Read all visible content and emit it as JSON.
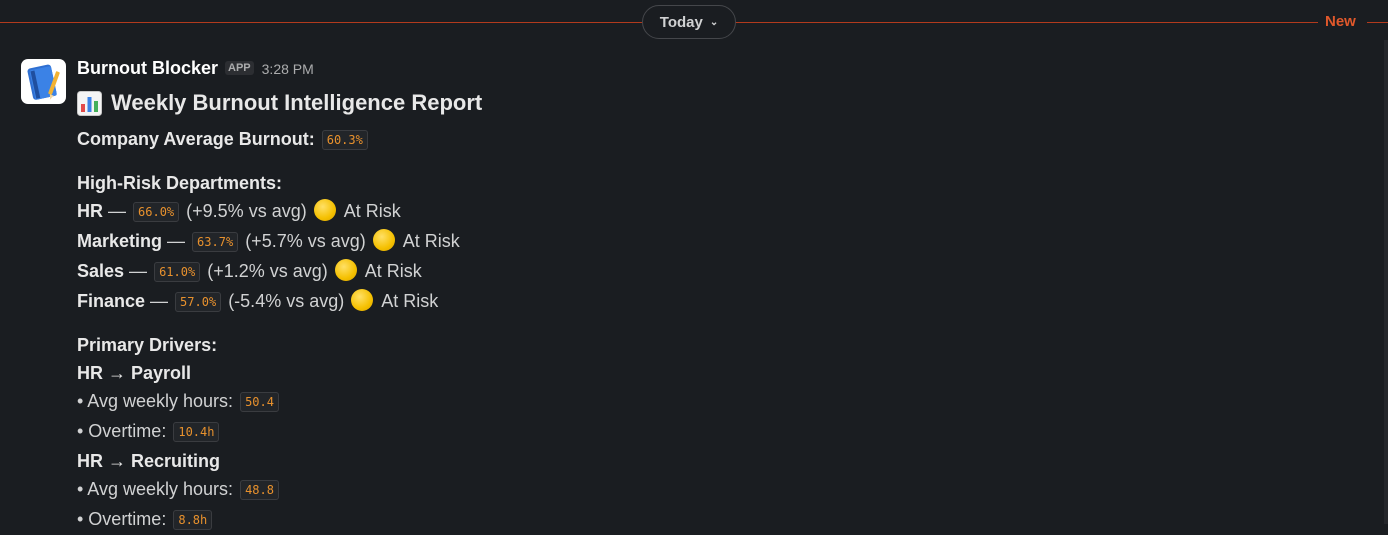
{
  "divider": {
    "label": "Today",
    "new_label": "New"
  },
  "message": {
    "sender": "Burnout Blocker",
    "badge": "APP",
    "time": "3:28 PM",
    "title": "Weekly Burnout Intelligence Report",
    "company_average_label": "Company Average Burnout:",
    "company_average_value": "60.3%",
    "high_risk_heading": "High-Risk Departments:",
    "departments": [
      {
        "name": "HR",
        "value": "66.0%",
        "delta": "(+9.5% vs avg)",
        "status": "At Risk"
      },
      {
        "name": "Marketing",
        "value": "63.7%",
        "delta": "(+5.7% vs avg)",
        "status": "At Risk"
      },
      {
        "name": "Sales",
        "value": "61.0%",
        "delta": "(+1.2% vs avg)",
        "status": "At Risk"
      },
      {
        "name": "Finance",
        "value": "57.0%",
        "delta": "(-5.4% vs avg)",
        "status": "At Risk"
      }
    ],
    "drivers_heading": "Primary Drivers:",
    "drivers": [
      {
        "title": "HR → Payroll",
        "hours_label": "• Avg weekly hours:",
        "hours": "50.4",
        "overtime_label": "• Overtime:",
        "overtime": "10.4h"
      },
      {
        "title": "HR → Recruiting",
        "hours_label": "• Avg weekly hours:",
        "hours": "48.8",
        "overtime_label": "• Overtime:",
        "overtime": "8.8h"
      }
    ]
  },
  "colors": {
    "accent_new": "#e0582b",
    "code_text": "#e8912d",
    "status_dot": "#f5c000"
  },
  "icons": {
    "avatar": "notebook-icon",
    "title": "bar-chart-icon",
    "status": "yellow-circle-icon"
  }
}
